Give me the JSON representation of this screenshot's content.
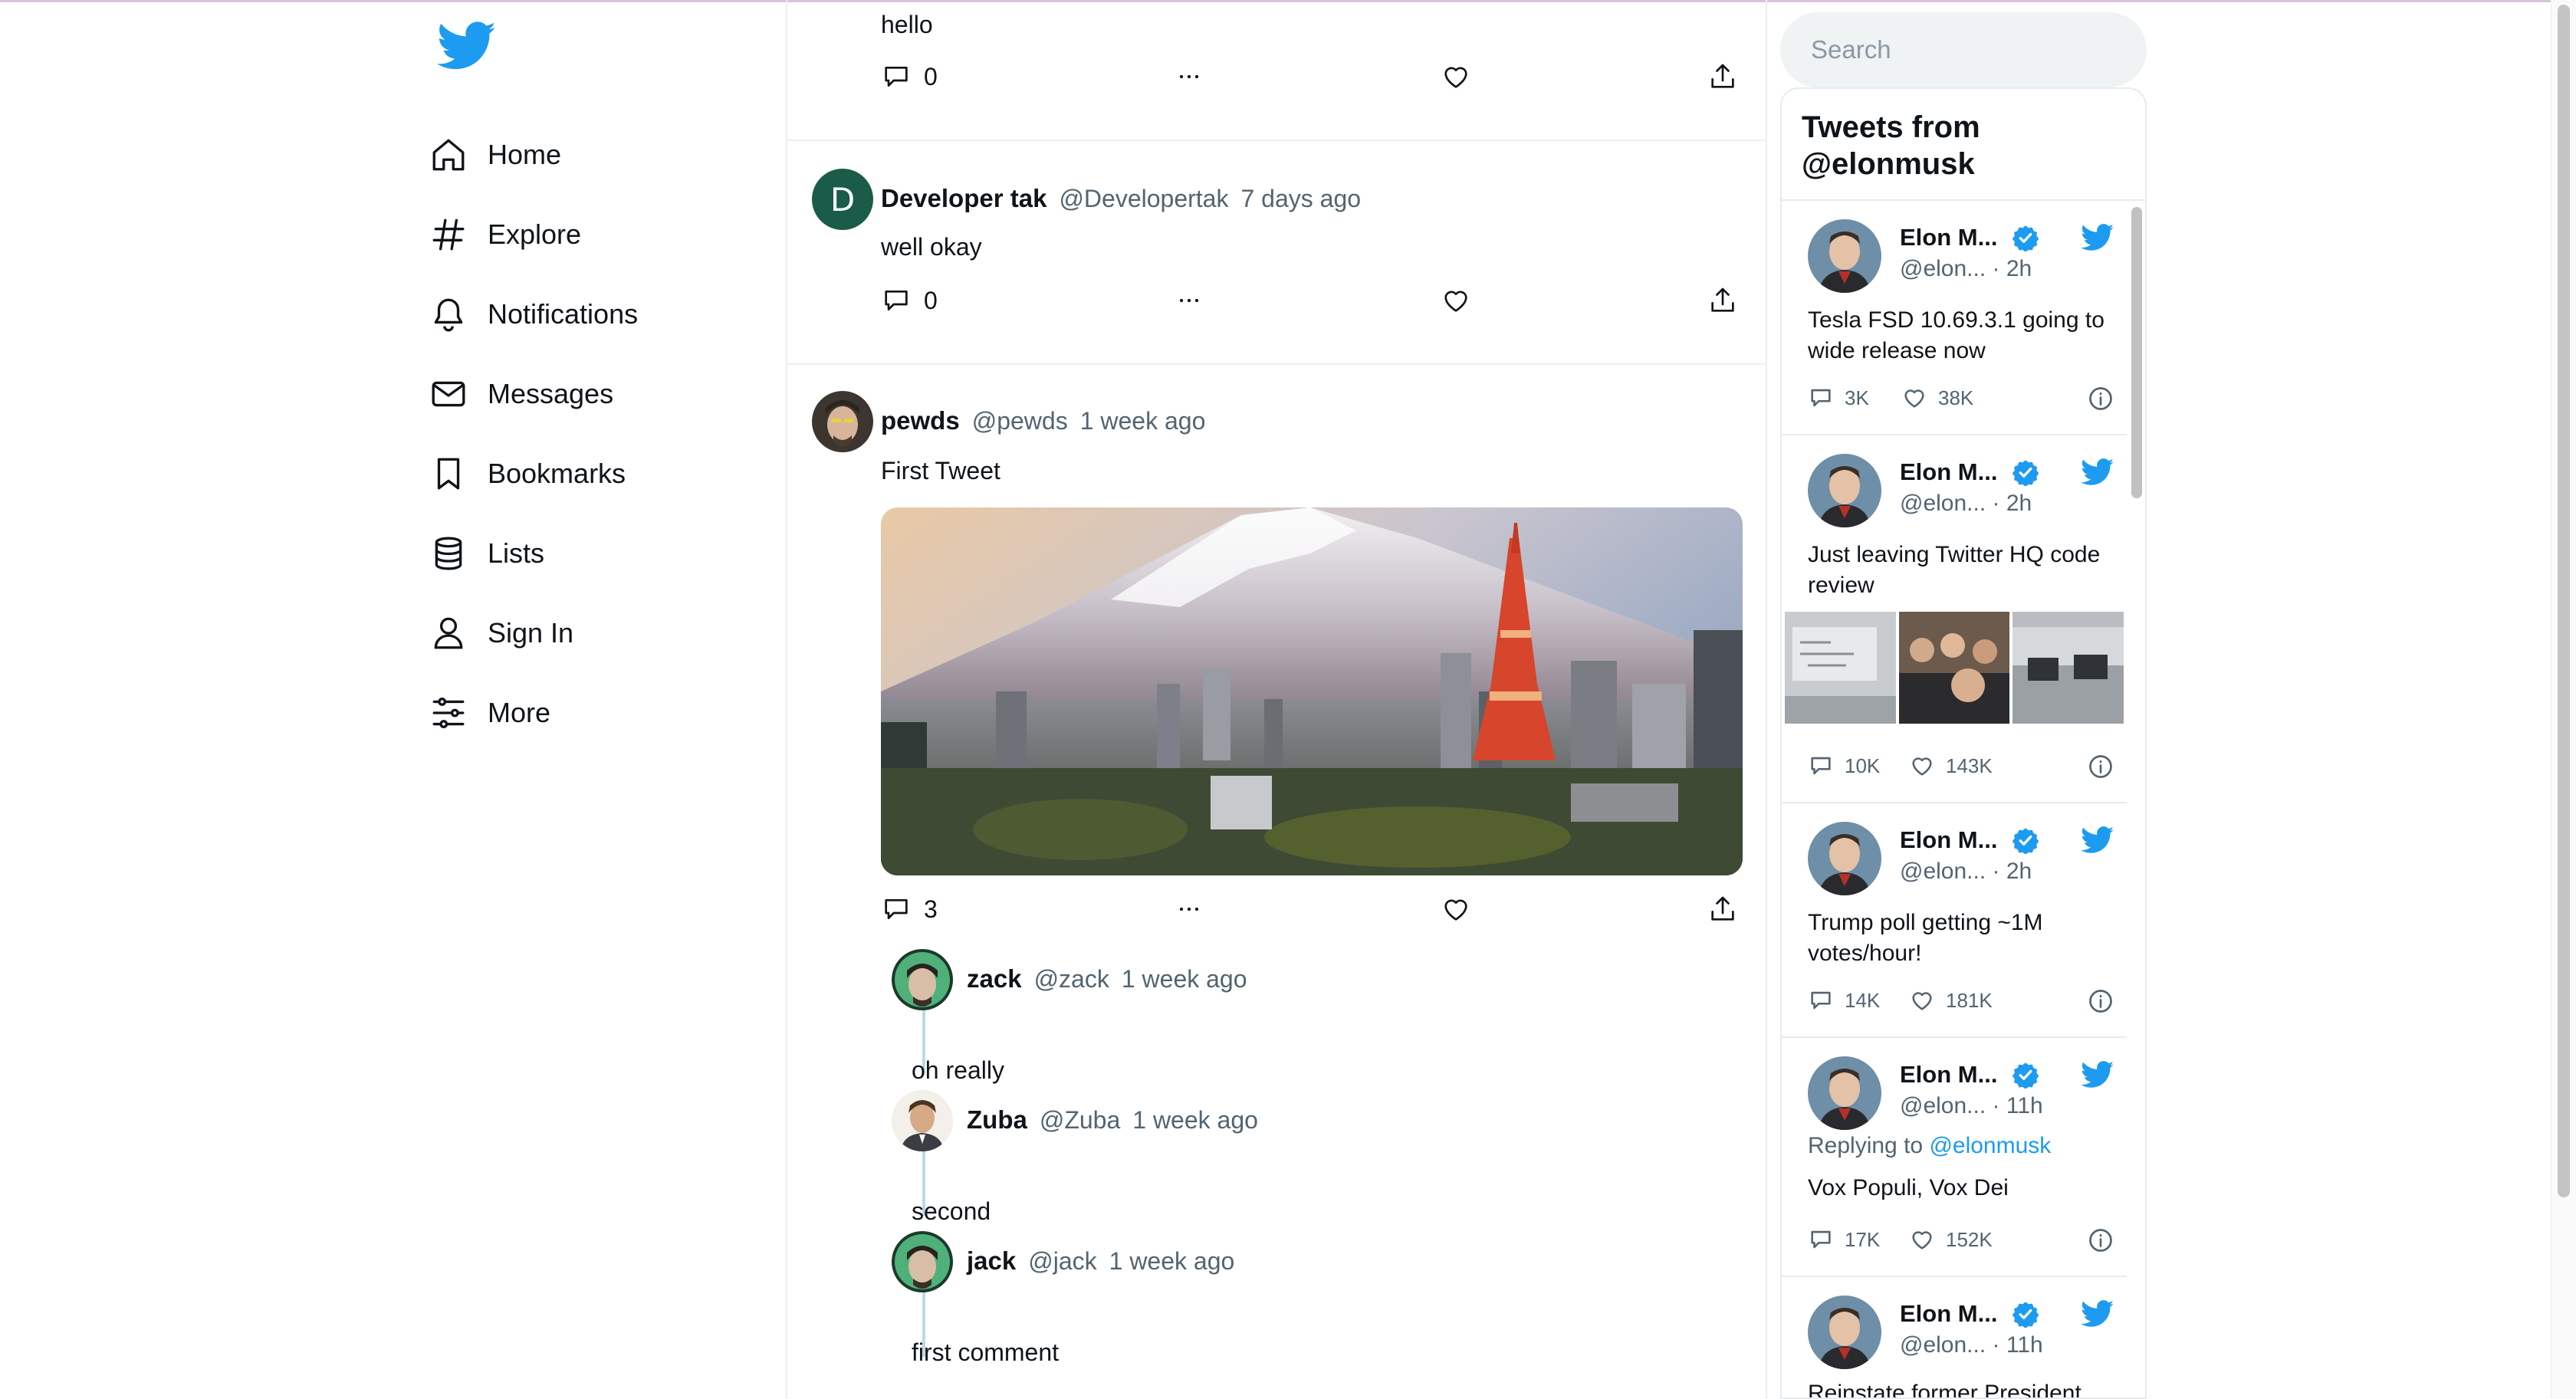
{
  "nav": {
    "items": [
      {
        "label": "Home",
        "icon": "home-icon"
      },
      {
        "label": "Explore",
        "icon": "hashtag-icon"
      },
      {
        "label": "Notifications",
        "icon": "bell-icon"
      },
      {
        "label": "Messages",
        "icon": "envelope-icon"
      },
      {
        "label": "Bookmarks",
        "icon": "bookmark-icon"
      },
      {
        "label": "Lists",
        "icon": "lists-icon"
      },
      {
        "label": "Sign In",
        "icon": "user-icon"
      },
      {
        "label": "More",
        "icon": "sliders-icon"
      }
    ]
  },
  "feed": {
    "tweets": [
      {
        "body": "hello",
        "comments": "0"
      },
      {
        "avatar_letter": "D",
        "name": "Developer tak",
        "handle": "@Developertak",
        "time": "7 days ago",
        "body": "well okay",
        "comments": "0"
      },
      {
        "name": "pewds",
        "handle": "@pewds",
        "time": "1 week ago",
        "body": "First Tweet",
        "comments": "3",
        "replies": [
          {
            "name": "zack",
            "handle": "@zack",
            "time": "1 week ago",
            "body": "oh really"
          },
          {
            "name": "Zuba",
            "handle": "@Zuba",
            "time": "1 week ago",
            "body": "second"
          },
          {
            "name": "jack",
            "handle": "@jack",
            "time": "1 week ago",
            "body": "first comment"
          }
        ]
      }
    ]
  },
  "sidebar": {
    "search_placeholder": "Search",
    "widget_title_line1": "Tweets from",
    "widget_title_line2": "@elonmusk",
    "embedded": [
      {
        "name": "Elon M...",
        "handle": "@elon... · 2h",
        "text": "Tesla FSD 10.69.3.1 going to wide release now",
        "replies": "3K",
        "likes": "38K"
      },
      {
        "name": "Elon M...",
        "handle": "@elon... · 2h",
        "text": "Just leaving Twitter HQ code review",
        "replies": "10K",
        "likes": "143K"
      },
      {
        "name": "Elon M...",
        "handle": "@elon... · 2h",
        "text": "Trump poll getting ~1M votes/hour!",
        "replies": "14K",
        "likes": "181K"
      },
      {
        "name": "Elon M...",
        "handle": "@elon... · 11h",
        "reply_prefix": "Replying to ",
        "reply_mention": "@elonmusk",
        "text": "Vox Populi, Vox Dei",
        "replies": "17K",
        "likes": "152K"
      },
      {
        "name": "Elon M...",
        "handle": "@elon... · 11h",
        "text": "Reinstate former President"
      }
    ]
  },
  "colors": {
    "brand": "#1d9bf0",
    "thread_line": "#bcd8ec",
    "avatar_d": "#1a5c48"
  }
}
